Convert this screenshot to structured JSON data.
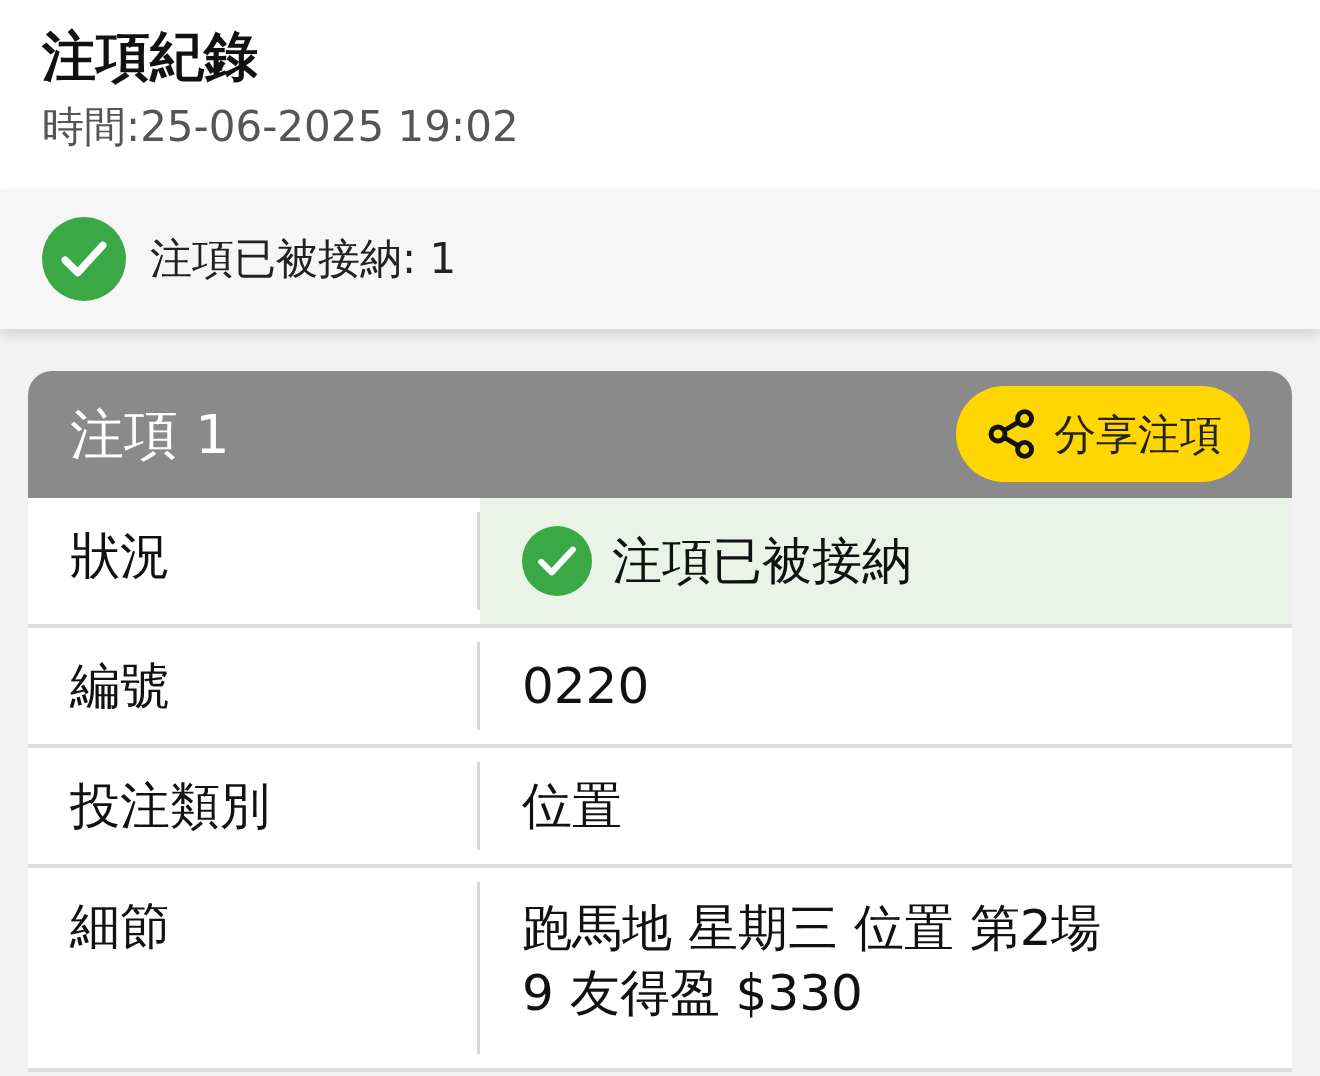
{
  "header": {
    "title": "注項紀錄",
    "time": "時間:25-06-2025 19:02"
  },
  "summary": {
    "accepted": true,
    "text": "注項已被接納: 1"
  },
  "bets": [
    {
      "title": "注項 1",
      "share_button": "分享注項",
      "rows": [
        {
          "kind": "status",
          "label": "狀況",
          "value": "注項已被接納",
          "accepted": true
        },
        {
          "kind": "text",
          "label": "編號",
          "value": "0220"
        },
        {
          "kind": "text",
          "label": "投注類別",
          "value": "位置"
        },
        {
          "kind": "lines",
          "label": "細節",
          "lines": [
            "跑馬地 星期三 位置 第2場",
            "9 友得盈 $330"
          ]
        }
      ]
    }
  ]
}
